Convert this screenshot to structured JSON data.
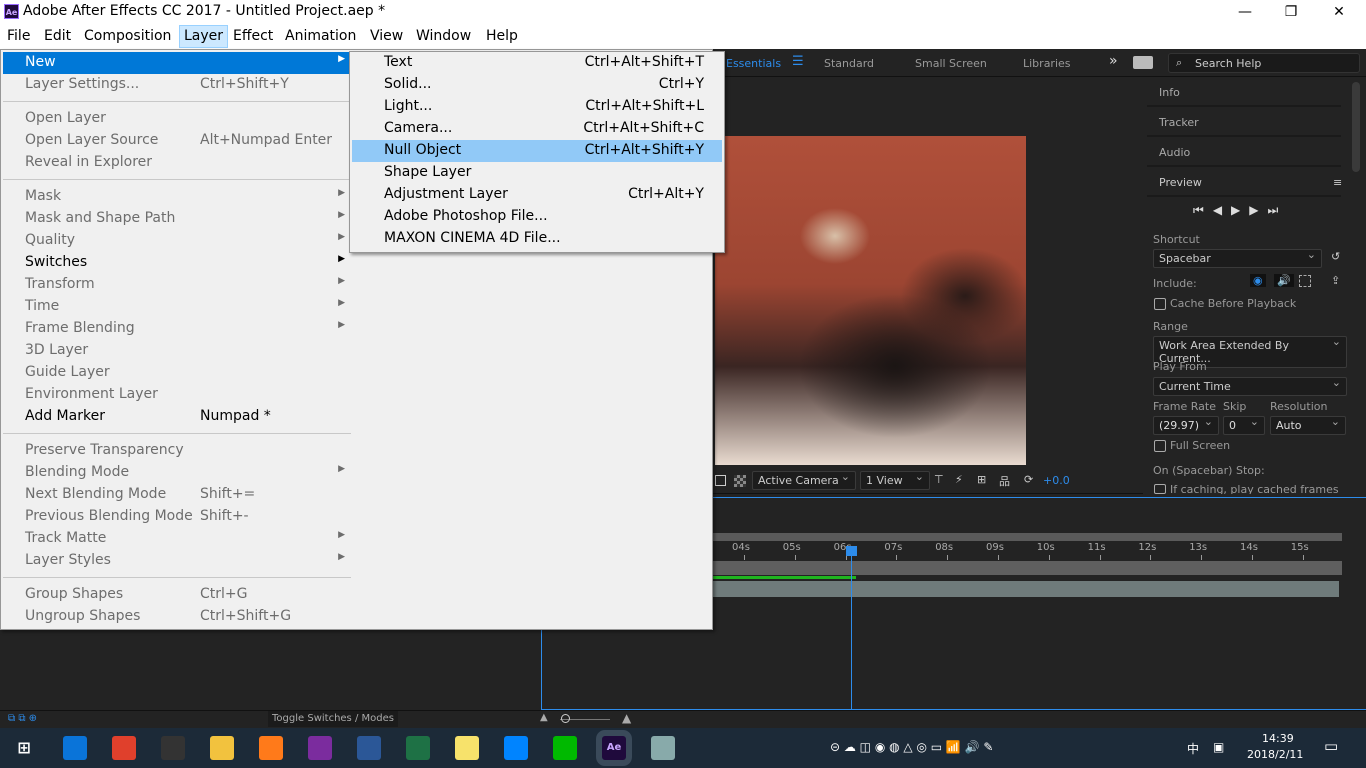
{
  "window": {
    "title": "Adobe After Effects CC 2017 - Untitled Project.aep *",
    "app_icon": "Ae",
    "minimize": "—",
    "maximize": "❐",
    "close": "✕"
  },
  "menubar": [
    "File",
    "Edit",
    "Composition",
    "Layer",
    "Effect",
    "Animation",
    "View",
    "Window",
    "Help"
  ],
  "workspace": {
    "tabs": [
      "Essentials",
      "Standard",
      "Small Screen",
      "Libraries"
    ],
    "active": "Essentials",
    "more": "»",
    "search_placeholder": "Search Help",
    "accent": "#2d8ceb"
  },
  "layer_menu": [
    {
      "label": "New",
      "enabled": true,
      "highlight": true,
      "submenu": true
    },
    {
      "label": "Layer Settings...",
      "shortcut": "Ctrl+Shift+Y",
      "enabled": false
    },
    {
      "sep": true
    },
    {
      "label": "Open Layer",
      "enabled": false
    },
    {
      "label": "Open Layer Source",
      "shortcut": "Alt+Numpad Enter",
      "enabled": false
    },
    {
      "label": "Reveal in Explorer",
      "enabled": false
    },
    {
      "sep": true
    },
    {
      "label": "Mask",
      "enabled": false,
      "submenu": true
    },
    {
      "label": "Mask and Shape Path",
      "enabled": false,
      "submenu": true
    },
    {
      "label": "Quality",
      "enabled": false,
      "submenu": true
    },
    {
      "label": "Switches",
      "enabled": true,
      "submenu": true
    },
    {
      "label": "Transform",
      "enabled": false,
      "submenu": true
    },
    {
      "label": "Time",
      "enabled": false,
      "submenu": true
    },
    {
      "label": "Frame Blending",
      "enabled": false,
      "submenu": true
    },
    {
      "label": "3D Layer",
      "enabled": false
    },
    {
      "label": "Guide Layer",
      "enabled": false
    },
    {
      "label": "Environment Layer",
      "enabled": false
    },
    {
      "label": "Add Marker",
      "shortcut": "Numpad *",
      "enabled": true
    },
    {
      "sep": true
    },
    {
      "label": "Preserve Transparency",
      "enabled": false
    },
    {
      "label": "Blending Mode",
      "enabled": false,
      "submenu": true
    },
    {
      "label": "Next Blending Mode",
      "shortcut": "Shift+=",
      "enabled": false
    },
    {
      "label": "Previous Blending Mode",
      "shortcut": "Shift+-",
      "enabled": false
    },
    {
      "label": "Track Matte",
      "enabled": false,
      "submenu": true
    },
    {
      "label": "Layer Styles",
      "enabled": false,
      "submenu": true
    },
    {
      "sep": true
    },
    {
      "label": "Group Shapes",
      "shortcut": "Ctrl+G",
      "enabled": false
    },
    {
      "label": "Ungroup Shapes",
      "shortcut": "Ctrl+Shift+G",
      "enabled": false
    }
  ],
  "new_submenu": [
    {
      "label": "Text",
      "shortcut": "Ctrl+Alt+Shift+T"
    },
    {
      "label": "Solid...",
      "shortcut": "Ctrl+Y"
    },
    {
      "label": "Light...",
      "shortcut": "Ctrl+Alt+Shift+L"
    },
    {
      "label": "Camera...",
      "shortcut": "Ctrl+Alt+Shift+C"
    },
    {
      "label": "Null Object",
      "shortcut": "Ctrl+Alt+Shift+Y",
      "highlight": true
    },
    {
      "label": "Shape Layer",
      "shortcut": ""
    },
    {
      "label": "Adjustment Layer",
      "shortcut": "Ctrl+Alt+Y"
    },
    {
      "label": "Adobe Photoshop File...",
      "shortcut": ""
    },
    {
      "label": "MAXON CINEMA 4D File...",
      "shortcut": ""
    }
  ],
  "viewer": {
    "camera": "Active Camera",
    "views": "1 View",
    "exposure": "+0.0"
  },
  "right_panel": {
    "tabs": [
      "Info",
      "Tracker",
      "Audio"
    ],
    "preview": {
      "title": "Preview",
      "shortcut_label": "Shortcut",
      "shortcut": "Spacebar",
      "include_label": "Include:",
      "cache_label": "Cache Before Playback",
      "cache_checked": false,
      "range_label": "Range",
      "range": "Work Area Extended By Current...",
      "play_from_label": "Play From",
      "play_from": "Current Time",
      "frame_rate_label": "Frame Rate",
      "frame_rate": "(29.97)",
      "skip_label": "Skip",
      "skip": "0",
      "resolution_label": "Resolution",
      "resolution": "Auto",
      "full_screen_label": "Full Screen",
      "full_screen_checked": false,
      "stop_label": "On (Spacebar) Stop:",
      "if_caching_label": "If caching, play cached frames"
    }
  },
  "timeline": {
    "ticks": [
      "04s",
      "05s",
      "06s",
      "07s",
      "08s",
      "09s",
      "10s",
      "11s",
      "12s",
      "13s",
      "14s",
      "15s"
    ],
    "current_time_s": 6.1,
    "toggle_label": "Toggle Switches / Modes"
  },
  "taskbar": {
    "apps": [
      "Edge",
      "Chrome",
      "Fox",
      "Explorer",
      "Firefox",
      "OneNote",
      "Word",
      "Excel",
      "Sticky Notes",
      "Messenger",
      "LINE",
      "After Effects",
      "Paint"
    ],
    "time": "14:39",
    "date": "2018/2/11",
    "ime": "中"
  }
}
